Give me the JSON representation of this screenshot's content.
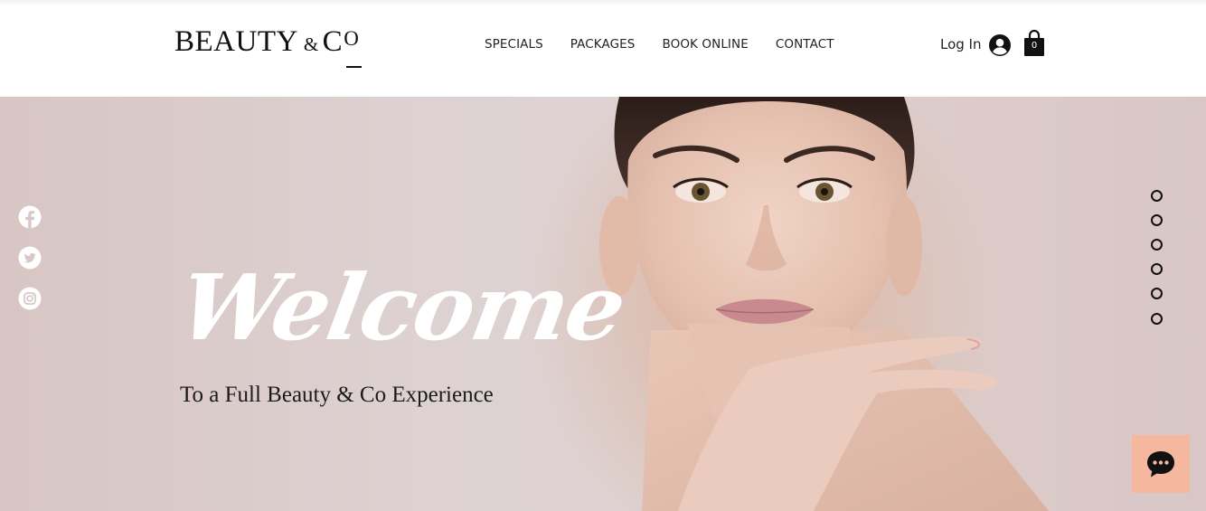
{
  "brand": {
    "main": "BEAUTY",
    "amp": "&",
    "c": "C",
    "o": "O"
  },
  "nav": {
    "items": [
      {
        "label": "SPECIALS"
      },
      {
        "label": "PACKAGES"
      },
      {
        "label": "BOOK ONLINE"
      },
      {
        "label": "CONTACT"
      }
    ]
  },
  "account": {
    "login_label": "Log In",
    "cart_count": "0"
  },
  "hero": {
    "welcome": "Welcome",
    "subtitle": "To a Full Beauty & Co Experience"
  },
  "social": [
    {
      "icon": "facebook-icon"
    },
    {
      "icon": "twitter-icon"
    },
    {
      "icon": "instagram-icon"
    }
  ],
  "colors": {
    "accent": "#f6b79f",
    "text": "#111111",
    "hero_bg": "#dccfce"
  }
}
